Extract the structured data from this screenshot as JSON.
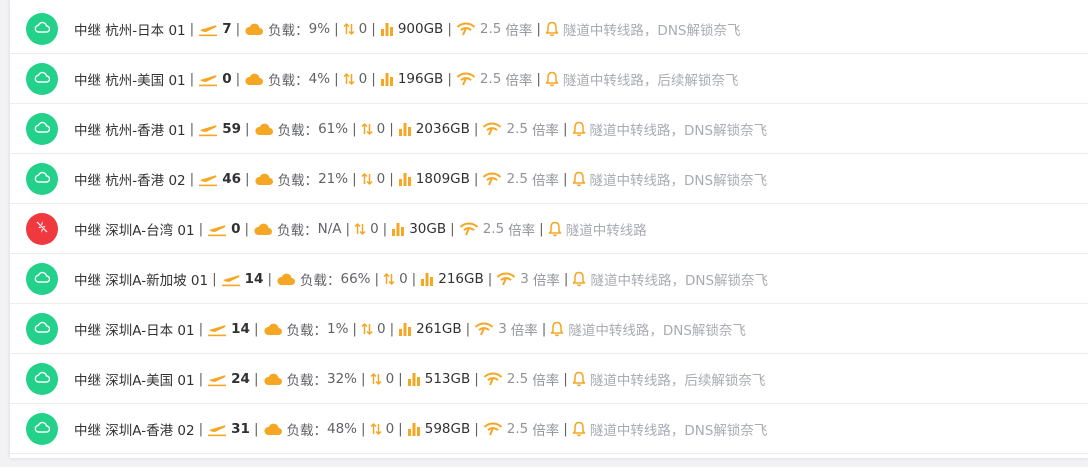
{
  "colors": {
    "online": "#23d18b",
    "offline": "#f0393e",
    "accent": "#f5a623"
  },
  "labels": {
    "load": "负载：",
    "rate_suffix": "倍率"
  },
  "nodes": [
    {
      "status": "online",
      "name": "中继 杭州-日本 01",
      "users": "7",
      "load": "9%",
      "speed": "0",
      "traffic": "900GB",
      "rate": "2.5",
      "note": "隧道中转线路，DNS解锁奈飞"
    },
    {
      "status": "online",
      "name": "中继 杭州-美国 01",
      "users": "0",
      "load": "4%",
      "speed": "0",
      "traffic": "196GB",
      "rate": "2.5",
      "note": "隧道中转线路，后续解锁奈飞"
    },
    {
      "status": "online",
      "name": "中继 杭州-香港 01",
      "users": "59",
      "load": "61%",
      "speed": "0",
      "traffic": "2036GB",
      "rate": "2.5",
      "note": "隧道中转线路，DNS解锁奈飞"
    },
    {
      "status": "online",
      "name": "中继 杭州-香港 02",
      "users": "46",
      "load": "21%",
      "speed": "0",
      "traffic": "1809GB",
      "rate": "2.5",
      "note": "隧道中转线路，DNS解锁奈飞"
    },
    {
      "status": "offline",
      "name": "中继 深圳A-台湾 01",
      "users": "0",
      "load": "N/A",
      "speed": "0",
      "traffic": "30GB",
      "rate": "2.5",
      "note": "隧道中转线路"
    },
    {
      "status": "online",
      "name": "中继 深圳A-新加坡 01",
      "users": "14",
      "load": "66%",
      "speed": "0",
      "traffic": "216GB",
      "rate": "3",
      "note": "隧道中转线路，DNS解锁奈飞"
    },
    {
      "status": "online",
      "name": "中继 深圳A-日本 01",
      "users": "14",
      "load": "1%",
      "speed": "0",
      "traffic": "261GB",
      "rate": "3",
      "note": "隧道中转线路，DNS解锁奈飞"
    },
    {
      "status": "online",
      "name": "中继 深圳A-美国 01",
      "users": "24",
      "load": "32%",
      "speed": "0",
      "traffic": "513GB",
      "rate": "2.5",
      "note": "隧道中转线路，后续解锁奈飞"
    },
    {
      "status": "online",
      "name": "中继 深圳A-香港 02",
      "users": "31",
      "load": "48%",
      "speed": "0",
      "traffic": "598GB",
      "rate": "2.5",
      "note": "隧道中转线路，DNS解锁奈飞"
    }
  ]
}
